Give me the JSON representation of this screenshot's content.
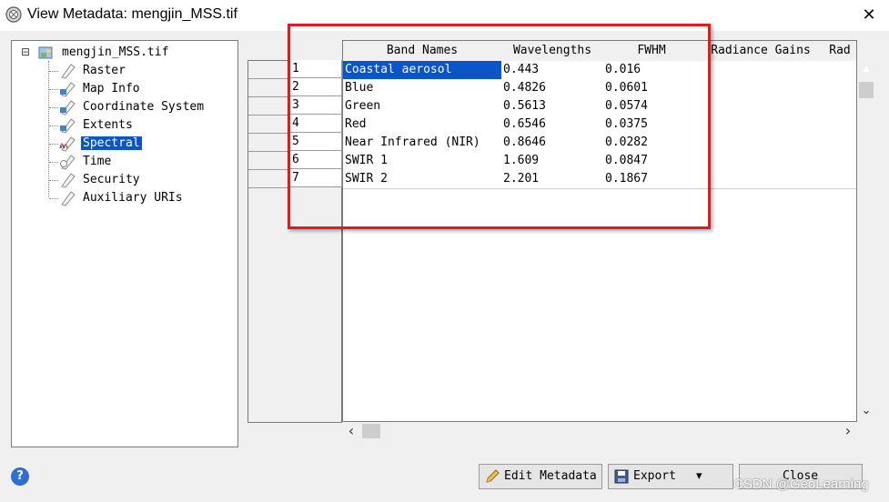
{
  "window": {
    "title": "View Metadata: mengjin_MSS.tif",
    "close_symbol": "✕"
  },
  "tree": {
    "expander": "⊟",
    "root": "mengjin_MSS.tif",
    "items": [
      {
        "label": "Raster",
        "icon": "raster-icon"
      },
      {
        "label": "Map Info",
        "icon": "map-info-icon"
      },
      {
        "label": "Coordinate System",
        "icon": "coordinate-system-icon"
      },
      {
        "label": "Extents",
        "icon": "extents-icon"
      },
      {
        "label": "Spectral",
        "icon": "spectral-icon",
        "selected": true
      },
      {
        "label": "Time",
        "icon": "time-icon"
      },
      {
        "label": "Security",
        "icon": "security-icon"
      },
      {
        "label": "Auxiliary URIs",
        "icon": "auxiliary-uris-icon"
      }
    ]
  },
  "table": {
    "columns": [
      "Band Names",
      "Wavelengths",
      "FWHM",
      "Radiance Gains",
      "Rad"
    ],
    "row_numbers": [
      "1",
      "2",
      "3",
      "4",
      "5",
      "6",
      "7"
    ],
    "rows": [
      [
        "Coastal aerosol",
        "0.443",
        "0.016",
        "",
        ""
      ],
      [
        "Blue",
        "0.4826",
        "0.0601",
        "",
        ""
      ],
      [
        "Green",
        "0.5613",
        "0.0574",
        "",
        ""
      ],
      [
        "Red",
        "0.6546",
        "0.0375",
        "",
        ""
      ],
      [
        "Near Infrared (NIR)",
        "0.8646",
        "0.0282",
        "",
        ""
      ],
      [
        "SWIR 1",
        "1.609",
        "0.0847",
        "",
        ""
      ],
      [
        "SWIR 2",
        "2.201",
        "0.1867",
        "",
        ""
      ]
    ],
    "selected_cell": "Coastal aerosol"
  },
  "scroll": {
    "up": "▲",
    "down": "⌄",
    "left": "‹",
    "right": "›"
  },
  "buttons": {
    "help": "?",
    "edit_metadata": "Edit Metadata",
    "export": "Export",
    "export_caret": "▾",
    "close": "Close"
  },
  "watermark": "CSDN @GeoLearning",
  "colors": {
    "selection": "#0a55c8",
    "highlight_box": "#e31a1c"
  }
}
